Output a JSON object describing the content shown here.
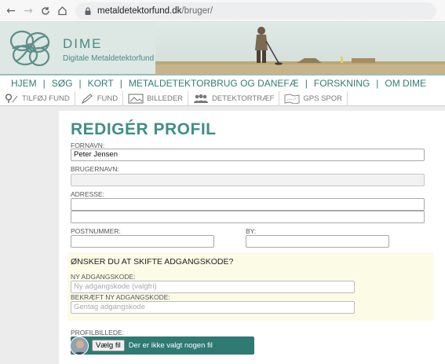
{
  "browser": {
    "back_glyph": "←",
    "forward_glyph": "→",
    "reload_glyph": "C",
    "home_glyph": "⌂",
    "url_host": "metaldetektorfund.dk",
    "url_path": "/bruger/"
  },
  "site": {
    "title": "DIME",
    "subtitle": "Digitale Metaldetektorfund",
    "accent_color": "#3f8f85"
  },
  "main_nav": {
    "items": [
      "HJEM",
      "SØG",
      "KORT",
      "METALDETEKTORBRUG OG DANEFÆ",
      "FORSKNING",
      "OM DIME"
    ],
    "separator": "|"
  },
  "sub_nav": {
    "items": [
      {
        "label": "TILFØJ FUND",
        "icon": "pin-icon"
      },
      {
        "label": "FUND",
        "icon": "pencil-icon"
      },
      {
        "label": "BILLEDER",
        "icon": "photo-icon"
      },
      {
        "label": "DETEKTORTRÆF",
        "icon": "group-icon"
      },
      {
        "label": "GPS SPOR",
        "icon": "map-icon"
      }
    ]
  },
  "form": {
    "title": "REDIGÉR PROFIL",
    "firstname_label": "FORNAVN:",
    "firstname_value": "Peter Jensen",
    "username_label": "BRUGERNAVN:",
    "username_value": "",
    "address_label": "ADRESSE:",
    "address_line1": "",
    "address_line2": "",
    "postcode_label": "POSTNUMMER:",
    "postcode_value": "",
    "city_label": "BY:",
    "city_value": "",
    "password_section_title": "ØNSKER DU AT SKIFTE ADGANGSKODE?",
    "new_password_label": "NY ADGANGSKODE:",
    "new_password_placeholder": "Ny adgangskode (valgfri)",
    "confirm_password_label": "BEKRÆFT NY ADGANGSKODE:",
    "confirm_password_placeholder": "Gentag adgangskode",
    "profile_picture_label": "PROFILBILLEDE:",
    "choose_file_label": "Vælg fil",
    "no_file_text": "Der er ikke valgt nogen fil"
  }
}
